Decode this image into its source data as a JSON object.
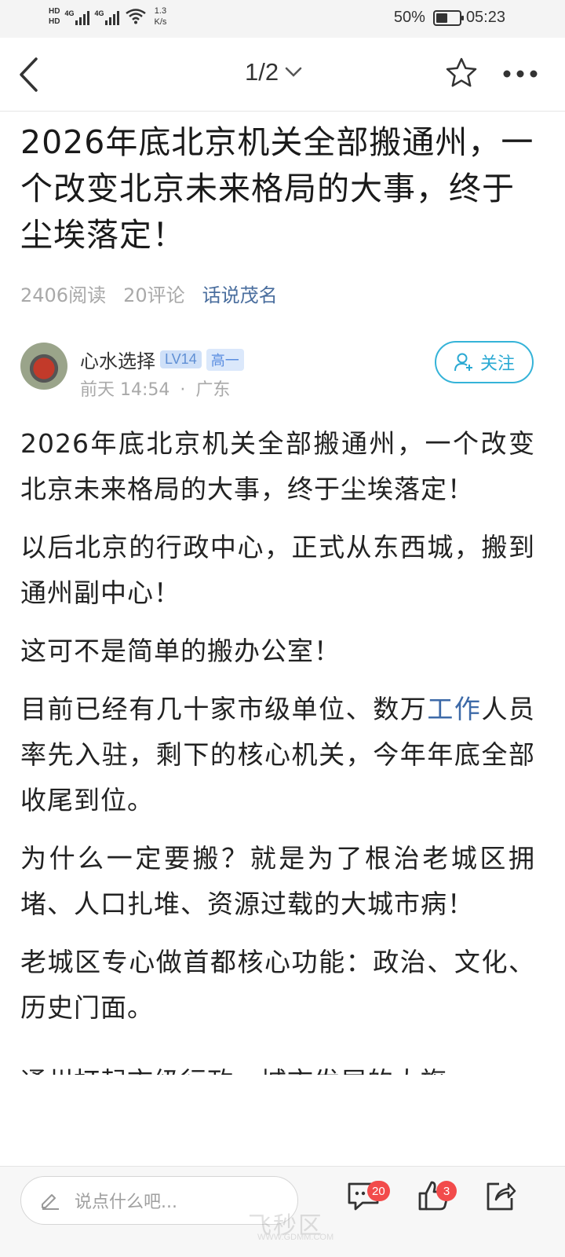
{
  "status_bar": {
    "hd1": "HD",
    "hd2": "HD",
    "net1": "4G",
    "net2": "4G",
    "speed_value": "1.3",
    "speed_unit": "K/s",
    "battery": "50%",
    "battery_level": 0.5,
    "time": "05:23"
  },
  "nav": {
    "page_indicator": "1/2"
  },
  "article": {
    "title": "2026年底北京机关全部搬通州，一个改变北京未来格局的大事，终于尘埃落定！",
    "reads": "2406阅读",
    "comments": "20评论",
    "topic": "话说茂名"
  },
  "author": {
    "name": "心水选择",
    "level": "LV14",
    "grade": "高一",
    "time": "前天 14:54",
    "separator": "·",
    "location": "广东",
    "follow_label": "关注"
  },
  "content": {
    "p1": "2026年底北京机关全部搬通州，一个改变北京未来格局的大事，终于尘埃落定！",
    "p2": "以后北京的行政中心，正式从东西城，搬到通州副中心！",
    "p3": "这可不是简单的搬办公室！",
    "p4_before": "目前已经有几十家市级单位、数万",
    "p4_link": "工作",
    "p4_after": "人员率先入驻，剩下的核心机关，今年年底全部收尾到位。",
    "p5": "为什么一定要搬？就是为了根治老城区拥堵、人口扎堆、资源过载的大城市病！",
    "p6": "老城区专心做首都核心功能：政治、文化、历史门面。",
    "p7": "通州打起市级行政，城市发展的大旗"
  },
  "bottom_bar": {
    "comment_placeholder": "说点什么吧...",
    "comment_count": "20",
    "like_count": "3",
    "watermark_main": "飞秒区",
    "watermark_url": "WWW.GDMM.COM"
  },
  "colors": {
    "accent": "#35b3d8",
    "link": "#3d6aa8",
    "badge_red": "#f24b4b"
  }
}
